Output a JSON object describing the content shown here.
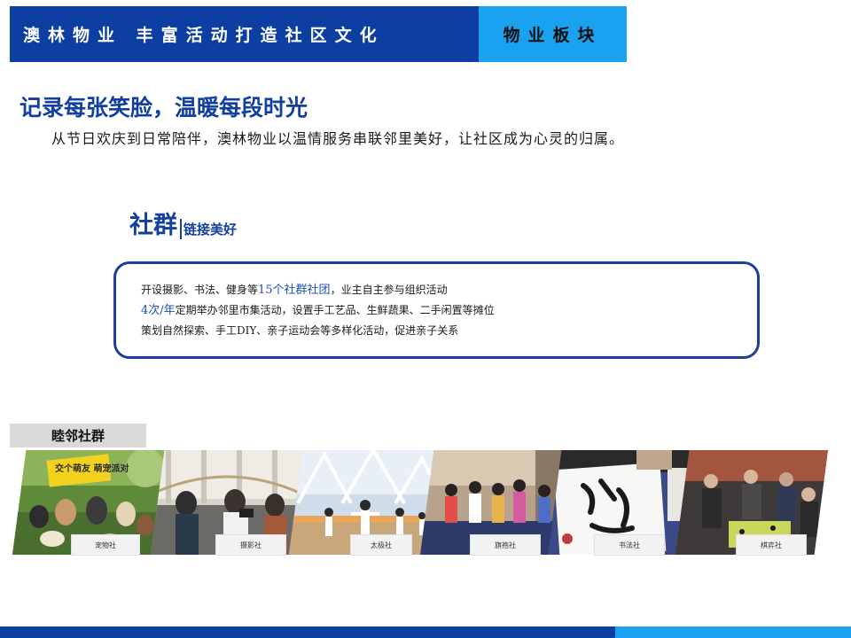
{
  "header": {
    "title": "澳林物业  丰富活动打造社区文化",
    "tag": "物业板块"
  },
  "page": {
    "title": "记录每张笑脸，温暖每段时光",
    "intro": "从节日欢庆到日常陪伴，澳林物业以温情服务串联邻里美好，让社区成为心灵的归属。"
  },
  "section": {
    "title": "社群",
    "subtitle": "链接美好"
  },
  "info": {
    "line1_pre": "开设摄影、书法、健身等",
    "line1_hl": "15个社群社团",
    "line1_post": "，业主自主参与组织活动",
    "line2_hl": "4次/年",
    "line2_post": "定期举办邻里市集活动，设置手工艺品、生鲜蔬果、二手闲置等摊位",
    "line3": "策划自然探索、手工DIY、亲子运动会等多样化活动，促进亲子关系"
  },
  "gallery": {
    "tab": "睦邻社群",
    "items": [
      {
        "label": "宠物社",
        "sign_text": "交个萌友 萌宠派对"
      },
      {
        "label": "摄影社"
      },
      {
        "label": "太极社"
      },
      {
        "label": "旗袍社"
      },
      {
        "label": "书法社"
      },
      {
        "label": "棋弈社"
      }
    ]
  },
  "colors": {
    "primary": "#0d3fa3",
    "accent": "#1aa1f0",
    "title_blue": "#123fa0",
    "box_border": "#1d3f99"
  }
}
